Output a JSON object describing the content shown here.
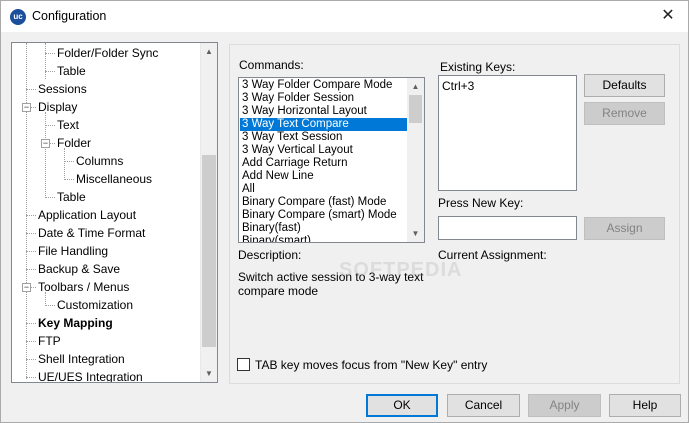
{
  "window": {
    "title": "Configuration",
    "app_icon": "uc-logo-icon",
    "close_glyph": "✕"
  },
  "tree": {
    "items": [
      {
        "label": "Folder/Folder Sync"
      },
      {
        "label": "Table"
      },
      {
        "label": "Sessions"
      },
      {
        "label": "Display"
      },
      {
        "label": "Text"
      },
      {
        "label": "Folder"
      },
      {
        "label": "Columns"
      },
      {
        "label": "Miscellaneous"
      },
      {
        "label": "Table"
      },
      {
        "label": "Application Layout"
      },
      {
        "label": "Date & Time Format"
      },
      {
        "label": "File Handling"
      },
      {
        "label": "Backup & Save"
      },
      {
        "label": "Toolbars / Menus"
      },
      {
        "label": "Customization"
      },
      {
        "label": "Key Mapping"
      },
      {
        "label": "FTP"
      },
      {
        "label": "Shell Integration"
      },
      {
        "label": "UE/UES Integration"
      }
    ],
    "selected": "Key Mapping",
    "expand_glyph": "−"
  },
  "commands": {
    "label": "Commands:",
    "items": [
      "3 Way Folder Compare Mode",
      "3 Way Folder Session",
      "3 Way Horizontal Layout",
      "3 Way Text Compare",
      "3 Way Text Session",
      "3 Way Vertical Layout",
      "Add Carriage Return",
      "Add New Line",
      "All",
      "Binary Compare (fast) Mode",
      "Binary Compare (smart) Mode",
      "Binary(fast)",
      "Binary(smart)"
    ],
    "selected_index": 3,
    "scroll_up": "▲",
    "scroll_down": "▼"
  },
  "existing_keys": {
    "label": "Existing Keys:",
    "value": "Ctrl+3"
  },
  "press_new_key": {
    "label": "Press New Key:",
    "value": "",
    "placeholder": ""
  },
  "current_assignment": {
    "label": "Current Assignment:"
  },
  "description": {
    "label": "Description:",
    "text": "Switch active session to 3-way text compare mode"
  },
  "tab_option": {
    "label": "TAB key moves focus from \"New Key\" entry",
    "checked": false
  },
  "buttons": {
    "defaults": "Defaults",
    "remove": "Remove",
    "assign": "Assign",
    "ok": "OK",
    "cancel": "Cancel",
    "apply": "Apply",
    "help": "Help"
  },
  "tree_scroll": {
    "up": "▲",
    "down": "▼"
  }
}
